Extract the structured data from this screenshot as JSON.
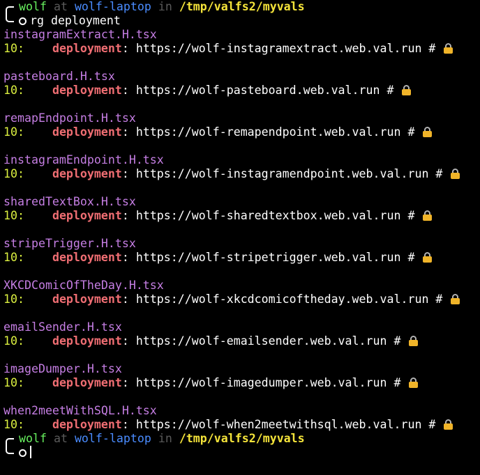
{
  "prompt": {
    "user": "wolf",
    "at": "at",
    "host": "wolf-laptop",
    "in": "in",
    "path": "/tmp/valfs2/myvals"
  },
  "command": "rg deployment",
  "results": [
    {
      "file": "instagramExtract.H.tsx",
      "line_no": "10:",
      "indent": "    ",
      "match": "deployment",
      "rest": ": https://wolf-instagramextract.web.val.run # "
    },
    {
      "file": "pasteboard.H.tsx",
      "line_no": "10:",
      "indent": "    ",
      "match": "deployment",
      "rest": ": https://wolf-pasteboard.web.val.run # "
    },
    {
      "file": "remapEndpoint.H.tsx",
      "line_no": "10:",
      "indent": "    ",
      "match": "deployment",
      "rest": ": https://wolf-remapendpoint.web.val.run # "
    },
    {
      "file": "instagramEndpoint.H.tsx",
      "line_no": "10:",
      "indent": "    ",
      "match": "deployment",
      "rest": ": https://wolf-instagramendpoint.web.val.run # "
    },
    {
      "file": "sharedTextBox.H.tsx",
      "line_no": "10:",
      "indent": "    ",
      "match": "deployment",
      "rest": ": https://wolf-sharedtextbox.web.val.run # "
    },
    {
      "file": "stripeTrigger.H.tsx",
      "line_no": "10:",
      "indent": "    ",
      "match": "deployment",
      "rest": ": https://wolf-stripetrigger.web.val.run # "
    },
    {
      "file": "XKCDComicOfTheDay.H.tsx",
      "line_no": "10:",
      "indent": "    ",
      "match": "deployment",
      "rest": ": https://wolf-xkcdcomicoftheday.web.val.run # "
    },
    {
      "file": "emailSender.H.tsx",
      "line_no": "10:",
      "indent": "    ",
      "match": "deployment",
      "rest": ": https://wolf-emailsender.web.val.run # "
    },
    {
      "file": "imageDumper.H.tsx",
      "line_no": "10:",
      "indent": "    ",
      "match": "deployment",
      "rest": ": https://wolf-imagedumper.web.val.run # "
    },
    {
      "file": "when2meetWithSQL.H.tsx",
      "line_no": "10:",
      "indent": "    ",
      "match": "deployment",
      "rest": ": https://wolf-when2meetwithsql.web.val.run # "
    }
  ],
  "icons": {
    "prompt_box": "box-drawing-corner",
    "prompt_marker": "circle-icon",
    "result_marker": "lock-icon",
    "cursor": "text-cursor"
  },
  "colors": {
    "background": "#000000",
    "user": "#67f05e",
    "dim": "#5a5a5a",
    "host": "#4a8cff",
    "path": "#f5e43a",
    "filename": "#c57ee3",
    "line_number": "#dcf040",
    "match": "#f06e73",
    "text": "#ffffff"
  }
}
